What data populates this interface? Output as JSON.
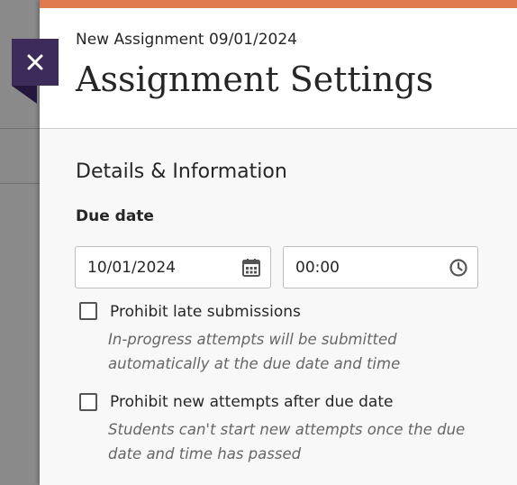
{
  "header": {
    "subtitle": "New Assignment 09/01/2024",
    "title": "Assignment Settings"
  },
  "close_icon": "close-icon",
  "section": {
    "title": "Details & Information",
    "due_date_label": "Due date",
    "date_value": "10/01/2024",
    "time_value": "00:00",
    "date_icon": "calendar-icon",
    "time_icon": "clock-icon"
  },
  "options": [
    {
      "label": "Prohibit late submissions",
      "checked": false,
      "hint_line1": "In-progress attempts will be submitted",
      "hint_line2": "automatically at the due date and time"
    },
    {
      "label": "Prohibit new attempts after due date",
      "checked": false,
      "hint_line1": "Students can't start new attempts once the due",
      "hint_line2": "date and time has passed"
    }
  ],
  "colors": {
    "accent": "#e07a4f",
    "close_button": "#3d2b5c"
  }
}
